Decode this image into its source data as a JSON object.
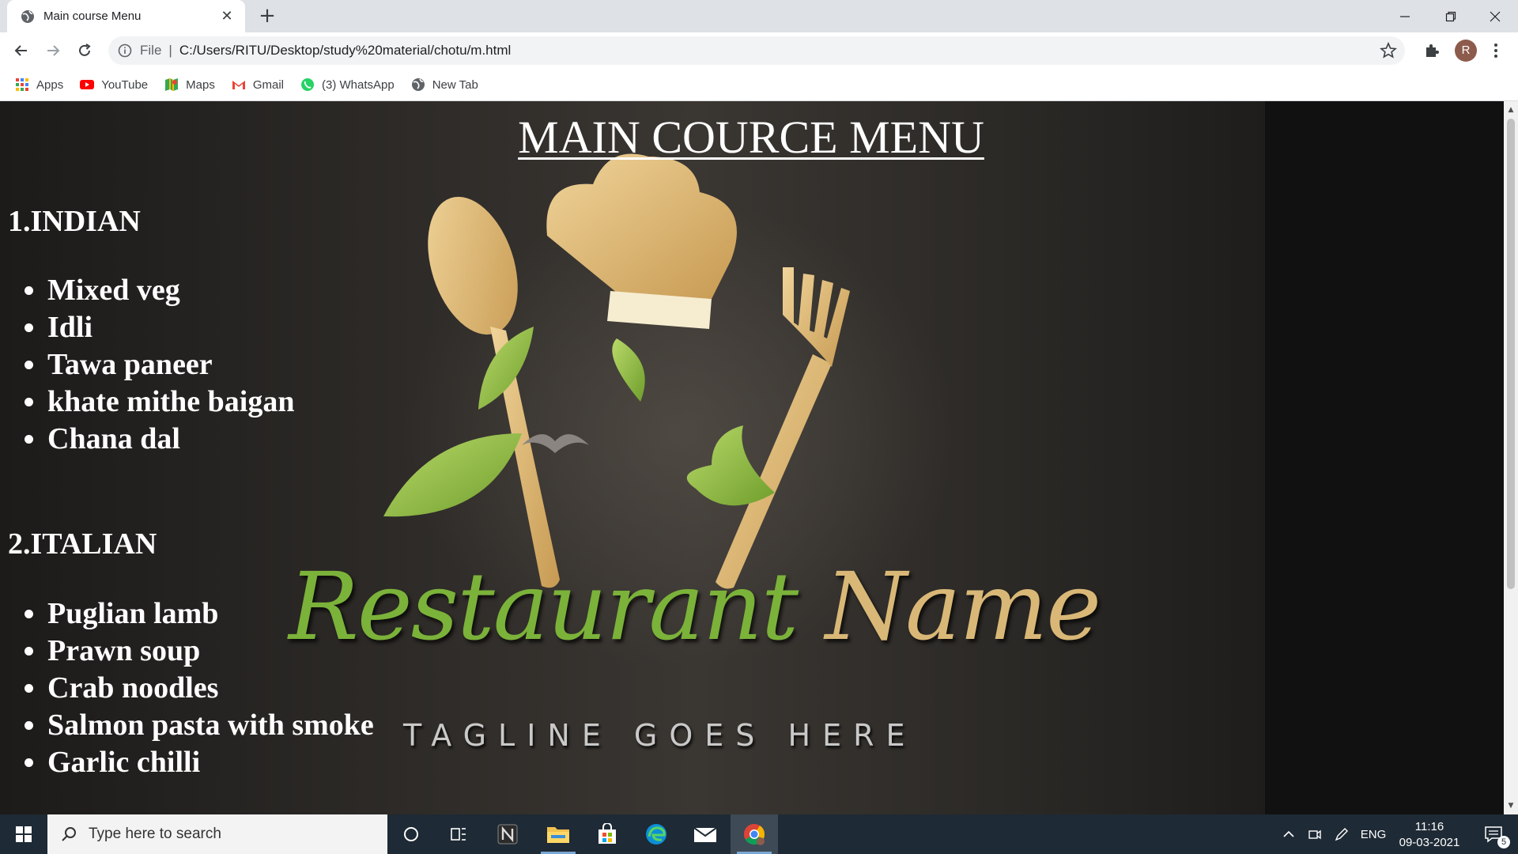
{
  "browser": {
    "tab_title": "Main course Menu",
    "new_tab_symbol": "+",
    "close_symbol": "✕",
    "omnibox": {
      "scheme": "File",
      "separator": "|",
      "url": "C:/Users/RITU/Desktop/study%20material/chotu/m.html"
    },
    "profile_initial": "R",
    "bookmarks": [
      {
        "label": "Apps",
        "icon": "apps-grid-icon"
      },
      {
        "label": "YouTube",
        "icon": "youtube-icon"
      },
      {
        "label": "Maps",
        "icon": "maps-icon"
      },
      {
        "label": "Gmail",
        "icon": "gmail-icon"
      },
      {
        "label": "(3) WhatsApp",
        "icon": "whatsapp-icon"
      },
      {
        "label": "New Tab",
        "icon": "globe-icon"
      }
    ]
  },
  "page": {
    "title": "MAIN COURCE MENU",
    "sections": [
      {
        "heading": "1.INDIAN",
        "items": [
          "Mixed veg",
          "Idli",
          "Tawa paneer",
          "khate mithe baigan",
          "Chana dal"
        ]
      },
      {
        "heading": "2.ITALIAN",
        "items": [
          "Puglian lamb",
          "Prawn soup",
          "Crab noodles",
          "Salmon pasta with smoke",
          "Garlic chilli"
        ]
      }
    ],
    "logo": {
      "brand_part1": "Restaurant",
      "brand_part2": "Name",
      "tagline": "TAGLINE GOES HERE"
    }
  },
  "taskbar": {
    "search_placeholder": "Type here to search",
    "language": "ENG",
    "time": "11:16",
    "date": "09-03-2021",
    "notification_count": "5"
  },
  "colors": {
    "leaf_green": "#7bb23a",
    "gold": "#d9b877",
    "taskbar": "#1e2a35"
  }
}
